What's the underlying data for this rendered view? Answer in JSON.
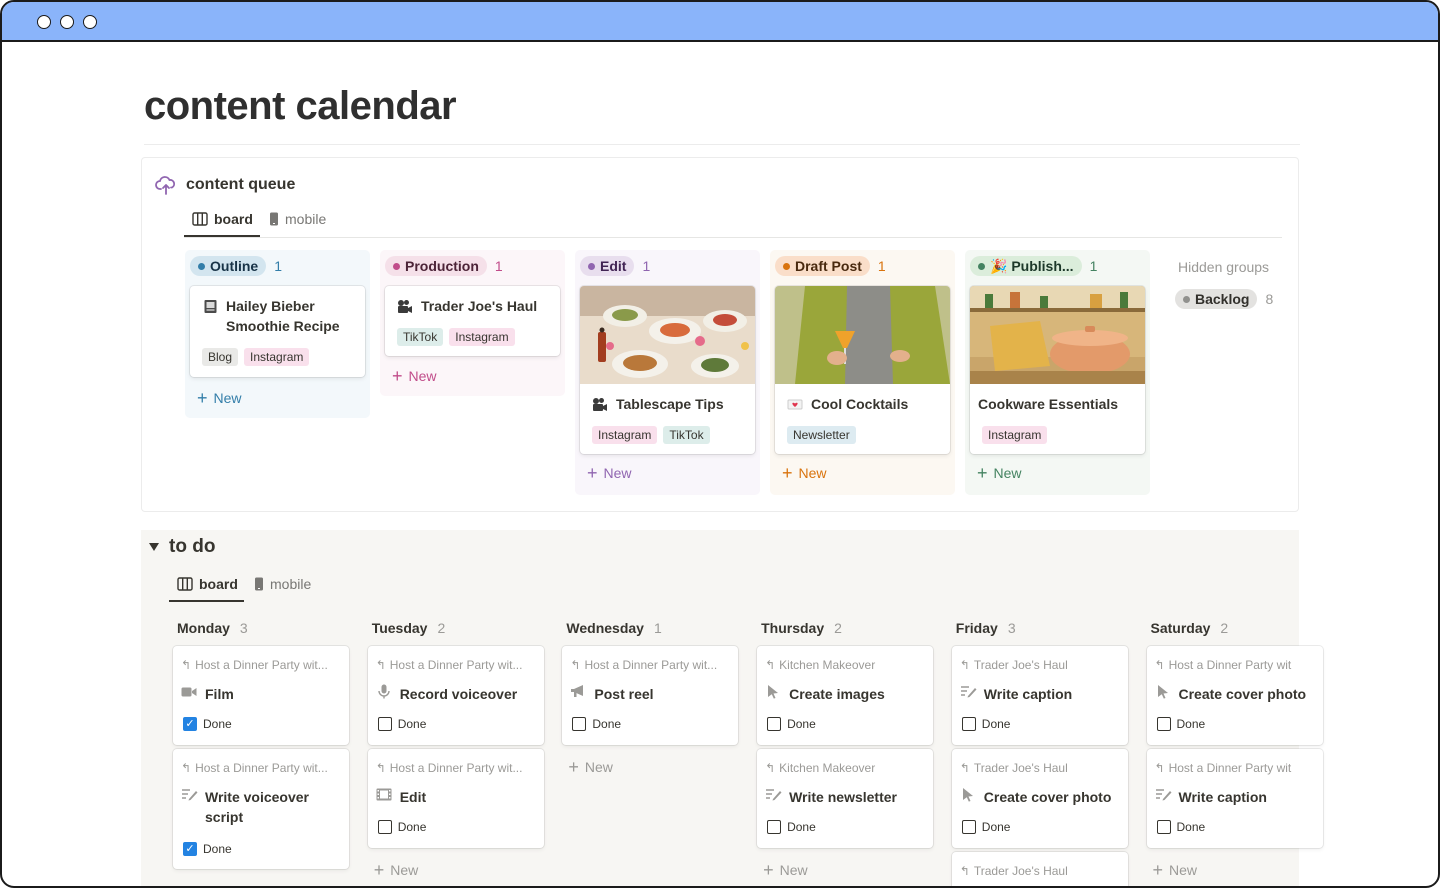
{
  "page": {
    "title": "content calendar"
  },
  "queue": {
    "title": "content queue",
    "icon": "cloud-upload-icon",
    "tabs": [
      {
        "label": "board",
        "icon": "board-icon"
      },
      {
        "label": "mobile",
        "icon": "phone-icon"
      }
    ],
    "columns": [
      {
        "name": "Outline",
        "count": "1",
        "dot": "#337ea9",
        "pill_bg": "#d3e5ef",
        "text": "#183347",
        "col_bg": "#f3f8fb",
        "new_color": "#337ea9",
        "cards": [
          {
            "icon": "book-icon",
            "title": "Hailey Bieber Smoothie Recipe",
            "tags": [
              "Blog",
              "Instagram"
            ]
          }
        ]
      },
      {
        "name": "Production",
        "count": "1",
        "dot": "#c14c8a",
        "pill_bg": "#f5e0e9",
        "text": "#4c2337",
        "col_bg": "#fcf6f9",
        "new_color": "#c14c8a",
        "cards": [
          {
            "icon": "camera-icon",
            "title": "Trader Joe's Haul",
            "tags": [
              "TikTok",
              "Instagram"
            ]
          }
        ]
      },
      {
        "name": "Edit",
        "count": "1",
        "dot": "#9065b0",
        "pill_bg": "#e8deee",
        "text": "#412454",
        "col_bg": "#f9f6fb",
        "new_color": "#9065b0",
        "cards": [
          {
            "icon": "camera-icon",
            "title": "Tablescape Tips",
            "tags": [
              "Instagram",
              "TikTok"
            ]
          }
        ]
      },
      {
        "name": "Draft Post",
        "count": "1",
        "dot": "#d9730d",
        "pill_bg": "#fadec9",
        "text": "#49290e",
        "col_bg": "#fcf8f2",
        "new_color": "#d9730d",
        "cards": [
          {
            "icon": "heart-letter-icon",
            "title": "Cool Cocktails",
            "tags": [
              "Newsletter"
            ]
          }
        ]
      },
      {
        "name": "🎉 Publish...",
        "count": "1",
        "dot": "#448361",
        "pill_bg": "#dbeddb",
        "text": "#1c3829",
        "col_bg": "#f4f8f4",
        "new_color": "#448361",
        "cards": [
          {
            "icon": "",
            "title": "Cookware Essentials",
            "tags": [
              "Instagram"
            ]
          }
        ]
      }
    ],
    "new_label": "New",
    "hidden_groups": {
      "label": "Hidden groups",
      "items": [
        {
          "name": "Backlog",
          "count": "8"
        }
      ]
    }
  },
  "todo": {
    "title": "to do",
    "tabs": [
      {
        "label": "board",
        "icon": "board-icon"
      },
      {
        "label": "mobile",
        "icon": "phone-icon"
      }
    ],
    "done_label": "Done",
    "new_label": "New",
    "days": [
      {
        "name": "Monday",
        "count": "3",
        "cards": [
          {
            "parent": "Host a Dinner Party wit...",
            "icon": "video-icon",
            "title": "Film",
            "done": true
          },
          {
            "parent": "Host a Dinner Party wit...",
            "icon": "script-icon",
            "title": "Write voiceover script",
            "done": true
          }
        ]
      },
      {
        "name": "Tuesday",
        "count": "2",
        "cards": [
          {
            "parent": "Host a Dinner Party wit...",
            "icon": "microphone-icon",
            "title": "Record voiceover",
            "done": false
          },
          {
            "parent": "Host a Dinner Party wit...",
            "icon": "film-icon",
            "title": "Edit",
            "done": false
          }
        ]
      },
      {
        "name": "Wednesday",
        "count": "1",
        "cards": [
          {
            "parent": "Host a Dinner Party wit...",
            "icon": "megaphone-icon",
            "title": "Post reel",
            "done": false
          }
        ]
      },
      {
        "name": "Thursday",
        "count": "2",
        "cards": [
          {
            "parent": "Kitchen Makeover",
            "icon": "cursor-icon",
            "title": "Create images",
            "done": false
          },
          {
            "parent": "Kitchen Makeover",
            "icon": "script-icon",
            "title": "Write newsletter",
            "done": false
          }
        ]
      },
      {
        "name": "Friday",
        "count": "3",
        "cards": [
          {
            "parent": "Trader Joe's Haul",
            "icon": "script-icon",
            "title": "Write caption",
            "done": false
          },
          {
            "parent": "Trader Joe's Haul",
            "icon": "cursor-icon",
            "title": "Create cover photo",
            "done": false
          },
          {
            "parent": "Trader Joe's Haul",
            "icon": "",
            "title": "",
            "done": false
          }
        ]
      },
      {
        "name": "Saturday",
        "count": "2",
        "cards": [
          {
            "parent": "Host a Dinner Party wit",
            "icon": "cursor-icon",
            "title": "Create cover photo",
            "done": false
          },
          {
            "parent": "Host a Dinner Party wit",
            "icon": "script-icon",
            "title": "Write caption",
            "done": false
          }
        ]
      }
    ]
  }
}
